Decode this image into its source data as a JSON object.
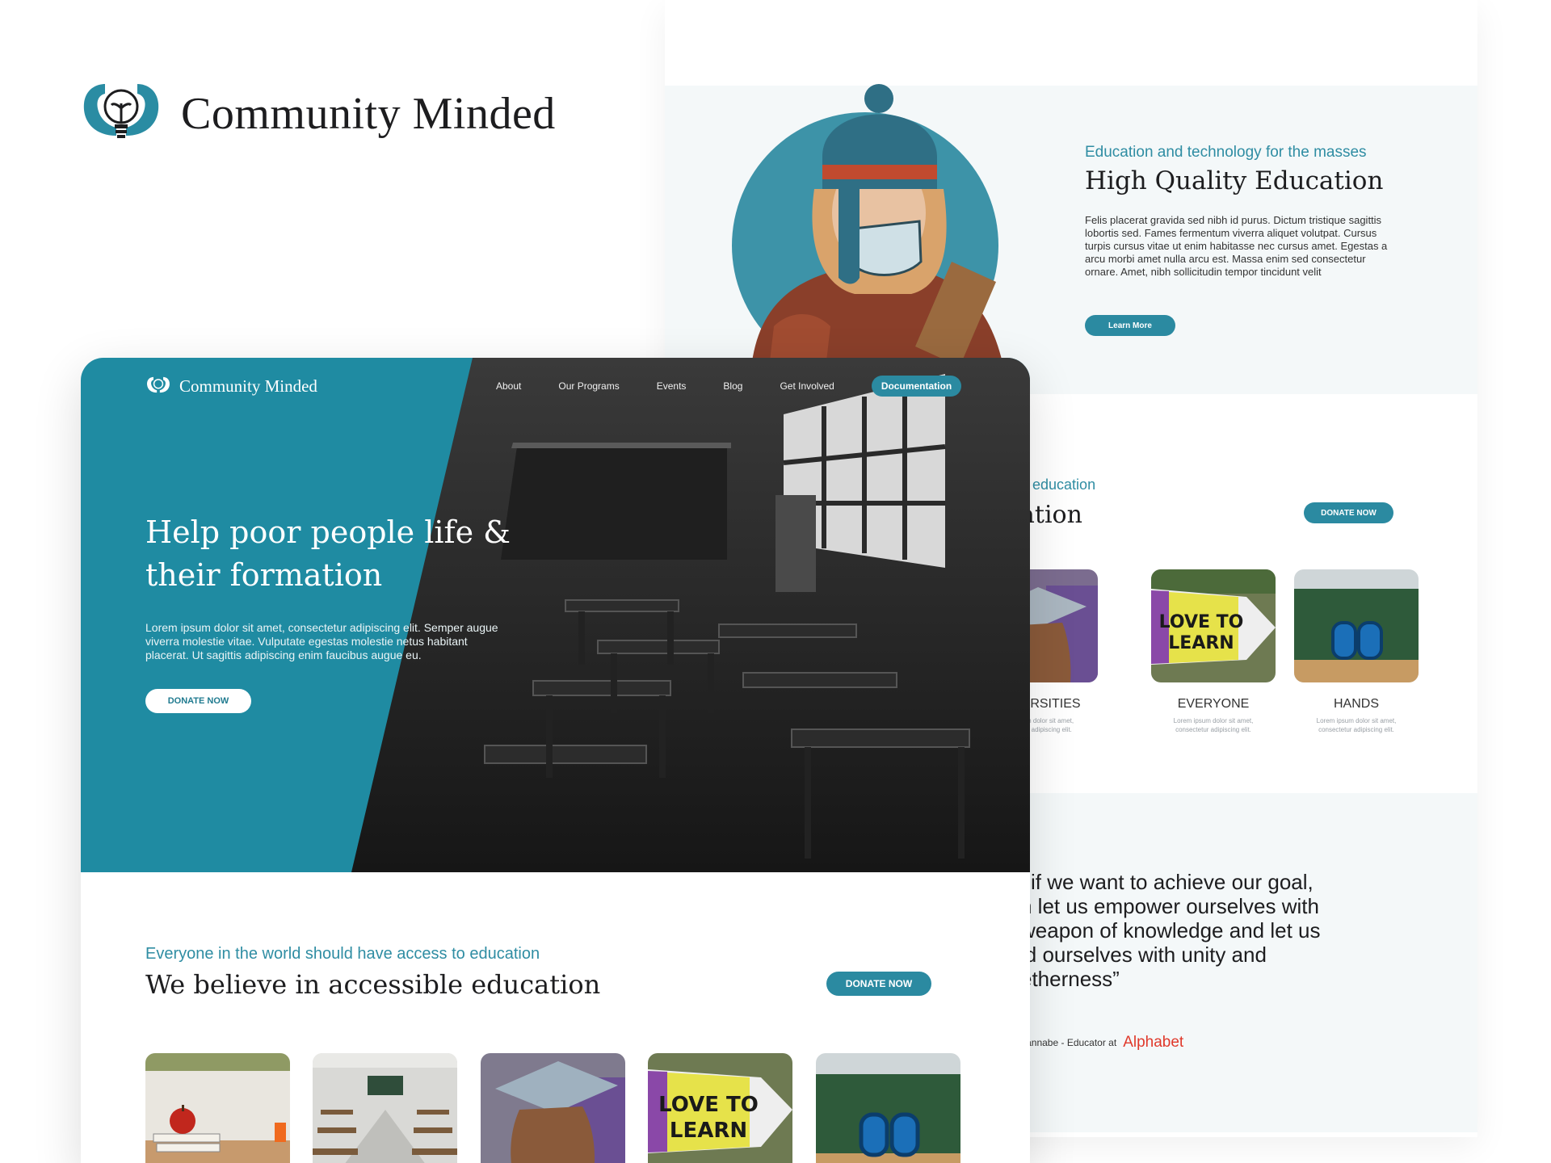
{
  "brand": {
    "name": "Community Minded",
    "logo_icon": "lightbulb-hands-icon"
  },
  "colors": {
    "primary": "#1f8ba2",
    "accent_red": "#e0392b",
    "band": "#f4f8f9"
  },
  "back_page": {
    "feature": {
      "eyebrow": "Education and technology for the masses",
      "title": "High Quality Education",
      "body": "Felis placerat gravida sed nibh id purus. Dictum tristique sagittis lobortis sed. Fames fermentum viverra aliquet volutpat. Cursus turpis cursus vitae ut enim habitasse nec cursus amet. Egestas a arcu morbi amet nulla arcu est. Massa enim sed consectetur ornare. Amet, nibh sollicitudin tempor tincidunt velit",
      "button": "Learn More"
    },
    "section": {
      "eyebrow_partial": "o education",
      "title_partial": "ation",
      "donate": "DONATE NOW"
    },
    "cards": [
      {
        "title": "UNIVERSITIES",
        "desc_line1": "orem ipsum dolor sit amet,",
        "desc_line2": "onsectetur adipiscing elit."
      },
      {
        "title": "EVERYONE",
        "desc_line1": "Lorem ipsum dolor sit amet,",
        "desc_line2": "consectetur adipiscing elit."
      },
      {
        "title": "HANDS",
        "desc_line1": "Lorem ipsum dolor sit amet,",
        "desc_line2": "consectetur adipiscing elit."
      }
    ],
    "quote": {
      "lines": [
        "l if we want to achieve our goal,",
        "n let us empower ourselves with",
        "weapon of knowledge and let us",
        "ld ourselves with unity and",
        "etherness”"
      ],
      "author": "Vannabe - Educator at",
      "company": "Alphabet"
    }
  },
  "front_page": {
    "nav": {
      "brand": "Community Minded",
      "links": [
        "About",
        "Our Programs",
        "Events",
        "Blog",
        "Get Involved"
      ],
      "cta": "Documentation"
    },
    "hero": {
      "title_line1": "Help poor people life &",
      "title_line2": "their formation",
      "body": "Lorem ipsum dolor sit amet, consectetur adipiscing elit. Semper augue viverra molestie vitae. Vulputate egestas molestie netus habitant placerat. Ut sagittis adipiscing enim faucibus augue eu.",
      "button": "DONATE NOW"
    },
    "section": {
      "eyebrow": "Everyone in the world should have access to education",
      "title": "We believe in accessible education",
      "donate": "DONATE NOW"
    },
    "cards": [
      "apple-books-photo",
      "classroom-photo",
      "graduate-photo",
      "love-to-learn-photo",
      "hands-building-photo"
    ]
  }
}
